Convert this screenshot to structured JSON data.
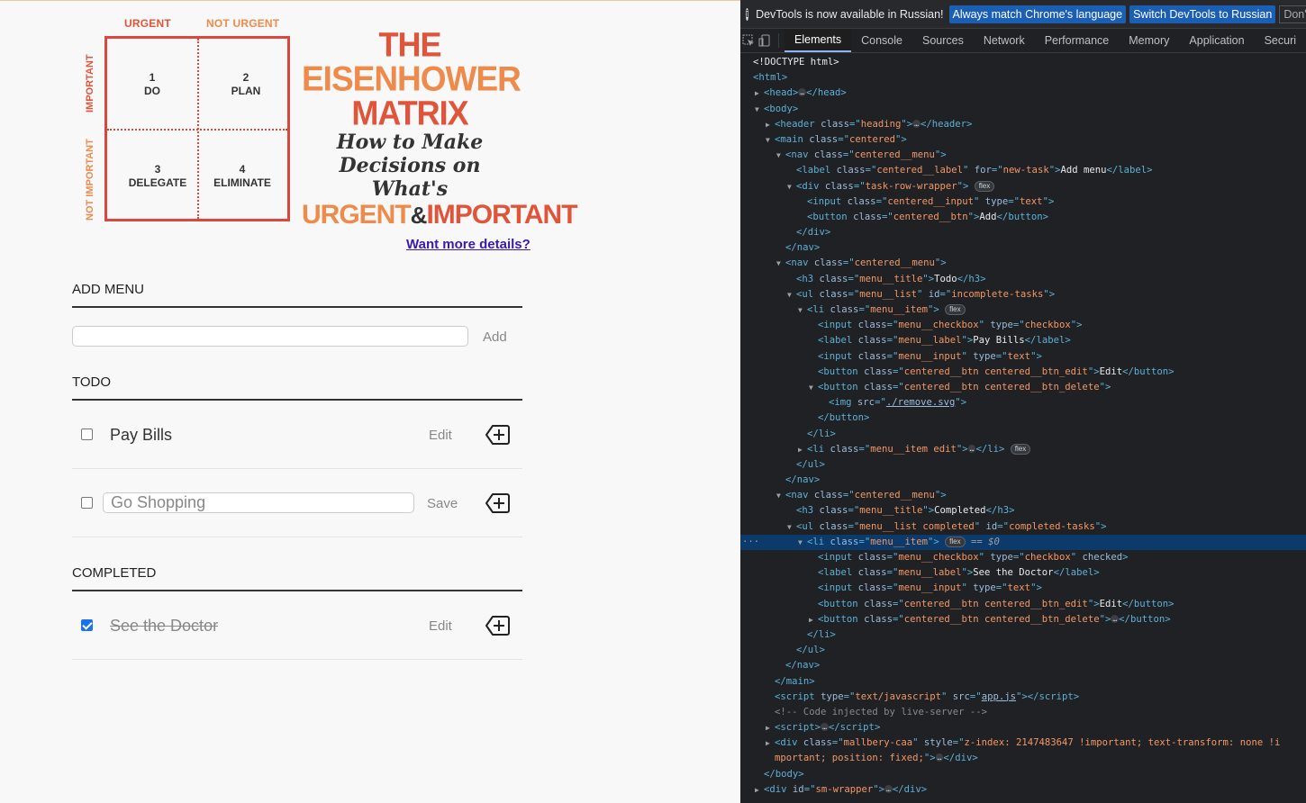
{
  "app": {
    "matrix": {
      "col_urgent": "URGENT",
      "col_not_urgent": "NOT URGENT",
      "row_important": "IMPORTANT",
      "row_not_important": "NOT IMPORTANT",
      "q1_num": "1",
      "q1_label": "DO",
      "q2_num": "2",
      "q2_label": "PLAN",
      "q3_num": "3",
      "q3_label": "DELEGATE",
      "q4_num": "4",
      "q4_label": "ELIMINATE"
    },
    "title": {
      "line1": "THE",
      "line2": "EISENHOWER",
      "line3": "MATRIX",
      "line4": "How to Make",
      "line5": "Decisions on What's",
      "urgent": "URGENT",
      "amp": "&",
      "important": "IMPORTANT"
    },
    "details_link": "Want more details?",
    "add_menu": {
      "title": "ADD MENU",
      "input_value": "",
      "add_label": "Add"
    },
    "todo": {
      "title": "TODO",
      "items": [
        {
          "label": "Pay Bills",
          "checked": false,
          "editing": false,
          "action": "Edit"
        },
        {
          "label": "Go Shopping",
          "checked": false,
          "editing": true,
          "action": "Save"
        }
      ]
    },
    "completed": {
      "title": "COMPLETED",
      "items": [
        {
          "label": "See the Doctor",
          "checked": true,
          "editing": false,
          "action": "Edit"
        }
      ]
    },
    "colors": {
      "accent_red": "#d9473d",
      "accent_orange": "#ee8a4a",
      "link": "#3b1aa6"
    }
  },
  "devtools": {
    "info_msg": "DevTools is now available in Russian!",
    "btn_match": "Always match Chrome's language",
    "btn_switch": "Switch DevTools to Russian",
    "btn_dont": "Don't sho",
    "tabs": [
      "Elements",
      "Console",
      "Sources",
      "Network",
      "Performance",
      "Memory",
      "Application",
      "Securi"
    ],
    "active_tab": "Elements",
    "flex_badge": "flex",
    "selected_marker": "== $0",
    "dom": {
      "doctype": "<!DOCTYPE html>",
      "html": "html",
      "head": "head",
      "body": "body",
      "header": "header",
      "main": "main",
      "nav": "nav",
      "label": "label",
      "div": "div",
      "input": "input",
      "button": "button",
      "h3": "h3",
      "ul": "ul",
      "li": "li",
      "img": "img",
      "script": "script",
      "class": "class",
      "for": "for",
      "type": "type",
      "id": "id",
      "src": "src",
      "style": "style",
      "checked": "checked",
      "heading": "heading",
      "centered": "centered",
      "centered_menu": "centered__menu",
      "centered_label": "centered__label",
      "new_task": "new-task",
      "add_menu_text": "Add menu",
      "task_row_wrapper": "task-row-wrapper",
      "centered_input": "centered__input",
      "text": "text",
      "centered_btn": "centered__btn",
      "add_text": "Add",
      "menu_title": "menu__title",
      "todo_text": "Todo",
      "menu_list": "menu__list",
      "incomplete_tasks": "incomplete-tasks",
      "menu_item": "menu__item",
      "menu_checkbox": "menu__checkbox",
      "checkbox": "checkbox",
      "menu_label": "menu__label",
      "pay_bills": "Pay Bills",
      "menu_input": "menu__input",
      "btn_edit_cls": "centered__btn centered__btn_edit",
      "edit_text": "Edit",
      "btn_delete_cls": "centered__btn centered__btn_delete",
      "remove_svg": "./remove.svg",
      "menu_item_edit": "menu__item edit",
      "completed_text": "Completed",
      "menu_list_completed": "menu__list completed",
      "completed_tasks": "completed-tasks",
      "see_doctor": "See the Doctor",
      "text_js": "text/javascript",
      "app_js": "app.js",
      "comment": "<!-- Code injected by live-server -->",
      "mallbery": "mallbery-caa",
      "mallbery_style_1": "z-index: 2147483647 !important; text-transform: none !i",
      "mallbery_style_2": "mportant; position: fixed;",
      "sm_wrapper": "sm-wrapper"
    }
  }
}
